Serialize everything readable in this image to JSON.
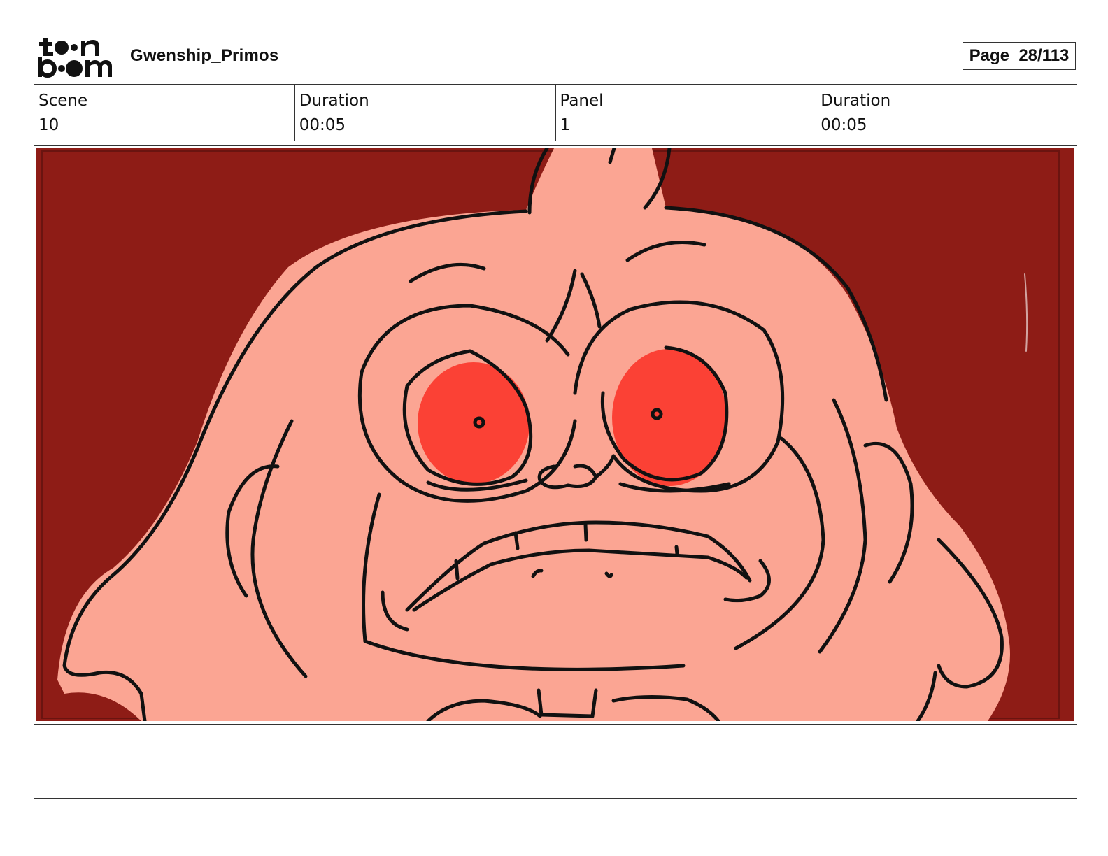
{
  "header": {
    "logo_name": "toon boom",
    "title": "Gwenship_Primos",
    "page_label": "Page",
    "page_value": "28/113"
  },
  "info": {
    "scene_label": "Scene",
    "scene_value": "10",
    "scene_duration_label": "Duration",
    "scene_duration_value": "00:05",
    "panel_label": "Panel",
    "panel_value": "1",
    "panel_duration_label": "Duration",
    "panel_duration_value": "00:05"
  },
  "panel": {
    "background_color": "#8e1c16",
    "skin_color": "#fba593",
    "eye_color": "#fb4135",
    "line_color": "#111111"
  },
  "notes": {
    "text": ""
  }
}
